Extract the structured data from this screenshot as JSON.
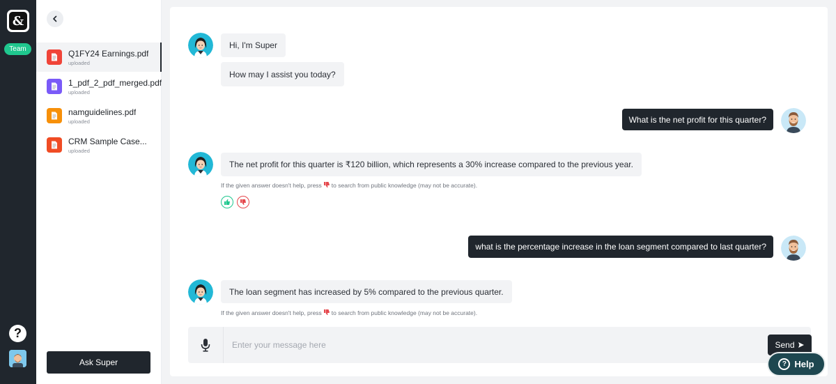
{
  "rail": {
    "team_label": "Team",
    "help_glyph": "?"
  },
  "sidebar": {
    "files": [
      {
        "name": "Q1FY24 Earnings.pdf",
        "status": "uploaded",
        "color": "#f04438",
        "active": true
      },
      {
        "name": "1_pdf_2_pdf_merged.pdf",
        "status": "uploaded",
        "color": "#7a5af8",
        "active": false
      },
      {
        "name": "namguidelines.pdf",
        "status": "uploaded",
        "color": "#f79009",
        "active": false
      },
      {
        "name": "CRM Sample Case...",
        "status": "uploaded",
        "color": "#f04c24",
        "active": false
      }
    ],
    "ask_button": "Ask Super"
  },
  "chat": {
    "greeting_1": "Hi, I'm Super",
    "greeting_2": "How may I assist you today?",
    "user_q1": "What is the net profit for this quarter?",
    "bot_a1": "The net profit for this quarter is ₹120 billion, which represents a 30% increase compared to the previous year.",
    "hint_before": "If the given answer doesn't help, press",
    "hint_after": "to search from public knowledge (may not be accurate).",
    "user_q2": "what is the percentage increase in the loan segment compared to last quarter?",
    "bot_a2": "The loan segment has increased by 5% compared to the previous quarter."
  },
  "composer": {
    "placeholder": "Enter your message here",
    "send_label": "Send"
  },
  "help_label": "Help",
  "colors": {
    "dark": "#20262d",
    "teal": "#1fc78e",
    "thumb_up": "#1fc78e",
    "thumb_down": "#e5484d"
  }
}
